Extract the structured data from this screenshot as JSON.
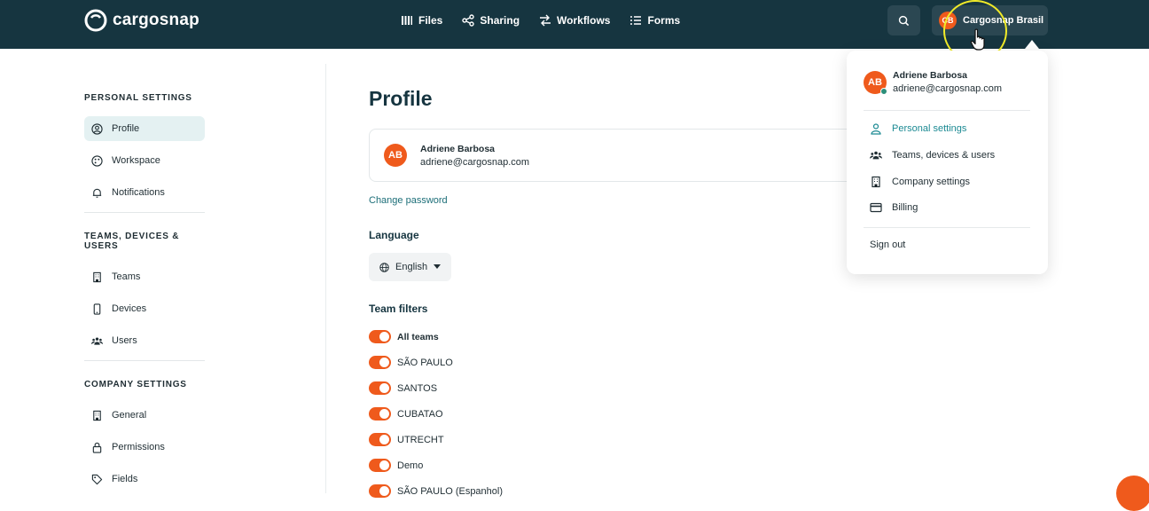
{
  "brand": {
    "name": "cargosnap"
  },
  "nav": [
    {
      "label": "Files",
      "icon": "files-icon"
    },
    {
      "label": "Sharing",
      "icon": "share-icon"
    },
    {
      "label": "Workflows",
      "icon": "workflow-icon"
    },
    {
      "label": "Forms",
      "icon": "forms-icon"
    }
  ],
  "account": {
    "initials": "CB",
    "label": "Cargosnap Brasil"
  },
  "sidebar": {
    "personal_title": "PERSONAL SETTINGS",
    "personal": [
      {
        "label": "Profile",
        "icon": "user-circle-icon"
      },
      {
        "label": "Workspace",
        "icon": "palette-icon"
      },
      {
        "label": "Notifications",
        "icon": "bell-icon"
      }
    ],
    "teams_title": "TEAMS, DEVICES & USERS",
    "teams": [
      {
        "label": "Teams",
        "icon": "building-icon"
      },
      {
        "label": "Devices",
        "icon": "phone-icon"
      },
      {
        "label": "Users",
        "icon": "users-icon"
      }
    ],
    "company_title": "COMPANY SETTINGS",
    "company": [
      {
        "label": "General",
        "icon": "building-icon"
      },
      {
        "label": "Permissions",
        "icon": "lock-icon"
      },
      {
        "label": "Fields",
        "icon": "tag-icon"
      }
    ]
  },
  "main": {
    "title": "Profile",
    "user": {
      "initials": "AB",
      "name": "Adriene Barbosa",
      "email": "adriene@cargosnap.com"
    },
    "change_password": "Change password",
    "language_label": "Language",
    "language_value": "English",
    "team_filters_label": "Team filters",
    "teams": [
      "All teams",
      "SÃO PAULO",
      "SANTOS",
      "CUBATAO",
      "UTRECHT",
      "Demo",
      "SÃO PAULO (Espanhol)"
    ]
  },
  "dropdown": {
    "name": "Adriene Barbosa",
    "email": "adriene@cargosnap.com",
    "initials": "AB",
    "items": [
      {
        "label": "Personal settings",
        "icon": "user-icon"
      },
      {
        "label": "Teams, devices & users",
        "icon": "users-icon"
      },
      {
        "label": "Company settings",
        "icon": "building-icon"
      },
      {
        "label": "Billing",
        "icon": "credit-card-icon"
      }
    ],
    "sign_out": "Sign out"
  },
  "colors": {
    "topbar": "#163540",
    "accent": "#ef5a1c",
    "link": "#1c6e78",
    "highlight": "#f0ea28"
  }
}
